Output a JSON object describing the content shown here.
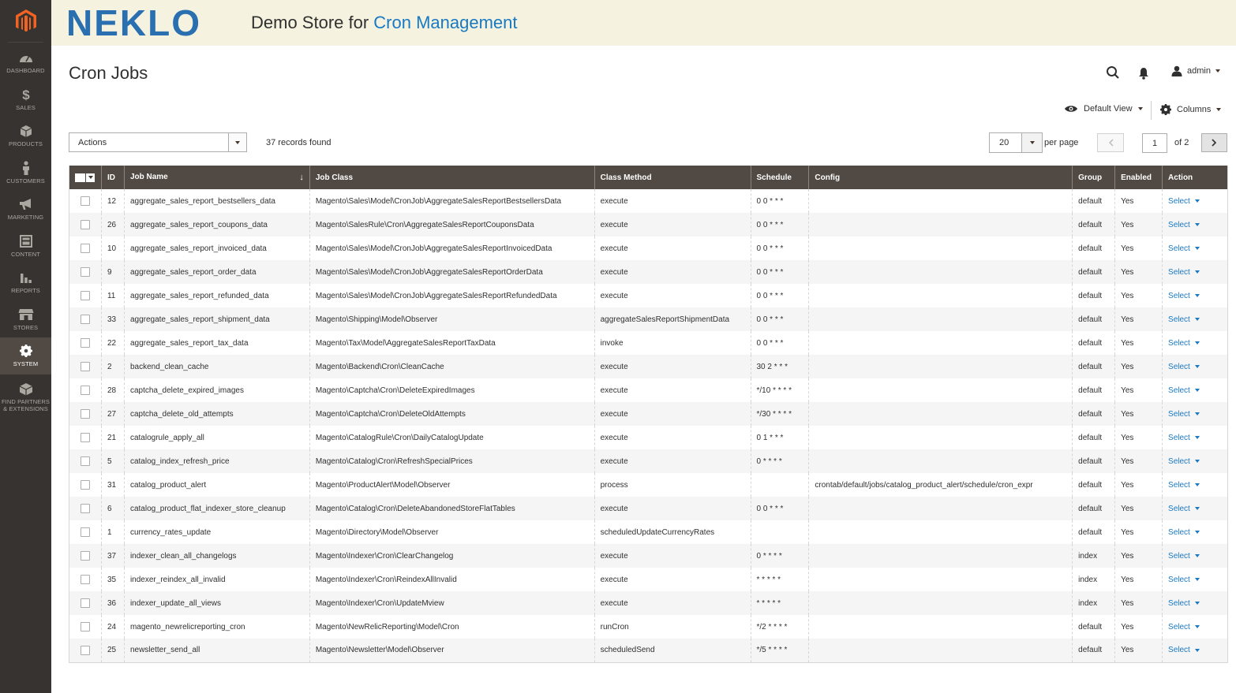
{
  "brand": {
    "logo_text": "NEKLO",
    "store_prefix": "Demo Store for ",
    "store_accent": "Cron Management",
    "accent_color": "#1979c3"
  },
  "sidebar": {
    "items": [
      {
        "label": "DASHBOARD",
        "icon": "dashboard-icon"
      },
      {
        "label": "SALES",
        "icon": "dollar-icon"
      },
      {
        "label": "PRODUCTS",
        "icon": "cube-icon"
      },
      {
        "label": "CUSTOMERS",
        "icon": "person-icon"
      },
      {
        "label": "MARKETING",
        "icon": "megaphone-icon"
      },
      {
        "label": "CONTENT",
        "icon": "layout-icon"
      },
      {
        "label": "REPORTS",
        "icon": "bar-chart-icon"
      },
      {
        "label": "STORES",
        "icon": "storefront-icon"
      },
      {
        "label": "SYSTEM",
        "icon": "gear-icon"
      },
      {
        "label": "FIND PARTNERS & EXTENSIONS",
        "icon": "box-icon"
      }
    ]
  },
  "page": {
    "title": "Cron Jobs"
  },
  "header": {
    "user": "admin"
  },
  "toolbar": {
    "view_label": "Default View",
    "columns_label": "Columns",
    "actions_label": "Actions",
    "records_found": "37 records found",
    "per_page_value": "20",
    "per_page_label": "per page",
    "current_page": "1",
    "of_pages": "of 2"
  },
  "grid": {
    "columns": [
      "ID",
      "Job Name",
      "Job Class",
      "Class Method",
      "Schedule",
      "Config",
      "Group",
      "Enabled",
      "Action"
    ],
    "action_label": "Select",
    "rows": [
      {
        "id": "12",
        "name": "aggregate_sales_report_bestsellers_data",
        "class": "Magento\\Sales\\Model\\CronJob\\AggregateSalesReportBestsellersData",
        "method": "execute",
        "schedule": "0 0 * * *",
        "config": "",
        "group": "default",
        "enabled": "Yes"
      },
      {
        "id": "26",
        "name": "aggregate_sales_report_coupons_data",
        "class": "Magento\\SalesRule\\Cron\\AggregateSalesReportCouponsData",
        "method": "execute",
        "schedule": "0 0 * * *",
        "config": "",
        "group": "default",
        "enabled": "Yes"
      },
      {
        "id": "10",
        "name": "aggregate_sales_report_invoiced_data",
        "class": "Magento\\Sales\\Model\\CronJob\\AggregateSalesReportInvoicedData",
        "method": "execute",
        "schedule": "0 0 * * *",
        "config": "",
        "group": "default",
        "enabled": "Yes"
      },
      {
        "id": "9",
        "name": "aggregate_sales_report_order_data",
        "class": "Magento\\Sales\\Model\\CronJob\\AggregateSalesReportOrderData",
        "method": "execute",
        "schedule": "0 0 * * *",
        "config": "",
        "group": "default",
        "enabled": "Yes"
      },
      {
        "id": "11",
        "name": "aggregate_sales_report_refunded_data",
        "class": "Magento\\Sales\\Model\\CronJob\\AggregateSalesReportRefundedData",
        "method": "execute",
        "schedule": "0 0 * * *",
        "config": "",
        "group": "default",
        "enabled": "Yes"
      },
      {
        "id": "33",
        "name": "aggregate_sales_report_shipment_data",
        "class": "Magento\\Shipping\\Model\\Observer",
        "method": "aggregateSalesReportShipmentData",
        "schedule": "0 0 * * *",
        "config": "",
        "group": "default",
        "enabled": "Yes"
      },
      {
        "id": "22",
        "name": "aggregate_sales_report_tax_data",
        "class": "Magento\\Tax\\Model\\AggregateSalesReportTaxData",
        "method": "invoke",
        "schedule": "0 0 * * *",
        "config": "",
        "group": "default",
        "enabled": "Yes"
      },
      {
        "id": "2",
        "name": "backend_clean_cache",
        "class": "Magento\\Backend\\Cron\\CleanCache",
        "method": "execute",
        "schedule": "30 2 * * *",
        "config": "",
        "group": "default",
        "enabled": "Yes"
      },
      {
        "id": "28",
        "name": "captcha_delete_expired_images",
        "class": "Magento\\Captcha\\Cron\\DeleteExpiredImages",
        "method": "execute",
        "schedule": "*/10 * * * *",
        "config": "",
        "group": "default",
        "enabled": "Yes"
      },
      {
        "id": "27",
        "name": "captcha_delete_old_attempts",
        "class": "Magento\\Captcha\\Cron\\DeleteOldAttempts",
        "method": "execute",
        "schedule": "*/30 * * * *",
        "config": "",
        "group": "default",
        "enabled": "Yes"
      },
      {
        "id": "21",
        "name": "catalogrule_apply_all",
        "class": "Magento\\CatalogRule\\Cron\\DailyCatalogUpdate",
        "method": "execute",
        "schedule": "0 1 * * *",
        "config": "",
        "group": "default",
        "enabled": "Yes"
      },
      {
        "id": "5",
        "name": "catalog_index_refresh_price",
        "class": "Magento\\Catalog\\Cron\\RefreshSpecialPrices",
        "method": "execute",
        "schedule": "0 * * * *",
        "config": "",
        "group": "default",
        "enabled": "Yes"
      },
      {
        "id": "31",
        "name": "catalog_product_alert",
        "class": "Magento\\ProductAlert\\Model\\Observer",
        "method": "process",
        "schedule": "",
        "config": "crontab/default/jobs/catalog_product_alert/schedule/cron_expr",
        "group": "default",
        "enabled": "Yes"
      },
      {
        "id": "6",
        "name": "catalog_product_flat_indexer_store_cleanup",
        "class": "Magento\\Catalog\\Cron\\DeleteAbandonedStoreFlatTables",
        "method": "execute",
        "schedule": "0 0 * * *",
        "config": "",
        "group": "default",
        "enabled": "Yes"
      },
      {
        "id": "1",
        "name": "currency_rates_update",
        "class": "Magento\\Directory\\Model\\Observer",
        "method": "scheduledUpdateCurrencyRates",
        "schedule": "",
        "config": "",
        "group": "default",
        "enabled": "Yes"
      },
      {
        "id": "37",
        "name": "indexer_clean_all_changelogs",
        "class": "Magento\\Indexer\\Cron\\ClearChangelog",
        "method": "execute",
        "schedule": "0 * * * *",
        "config": "",
        "group": "index",
        "enabled": "Yes"
      },
      {
        "id": "35",
        "name": "indexer_reindex_all_invalid",
        "class": "Magento\\Indexer\\Cron\\ReindexAllInvalid",
        "method": "execute",
        "schedule": "* * * * *",
        "config": "",
        "group": "index",
        "enabled": "Yes"
      },
      {
        "id": "36",
        "name": "indexer_update_all_views",
        "class": "Magento\\Indexer\\Cron\\UpdateMview",
        "method": "execute",
        "schedule": "* * * * *",
        "config": "",
        "group": "index",
        "enabled": "Yes"
      },
      {
        "id": "24",
        "name": "magento_newrelicreporting_cron",
        "class": "Magento\\NewRelicReporting\\Model\\Cron",
        "method": "runCron",
        "schedule": "*/2 * * * *",
        "config": "",
        "group": "default",
        "enabled": "Yes"
      },
      {
        "id": "25",
        "name": "newsletter_send_all",
        "class": "Magento\\Newsletter\\Model\\Observer",
        "method": "scheduledSend",
        "schedule": "*/5 * * * *",
        "config": "",
        "group": "default",
        "enabled": "Yes"
      }
    ]
  }
}
